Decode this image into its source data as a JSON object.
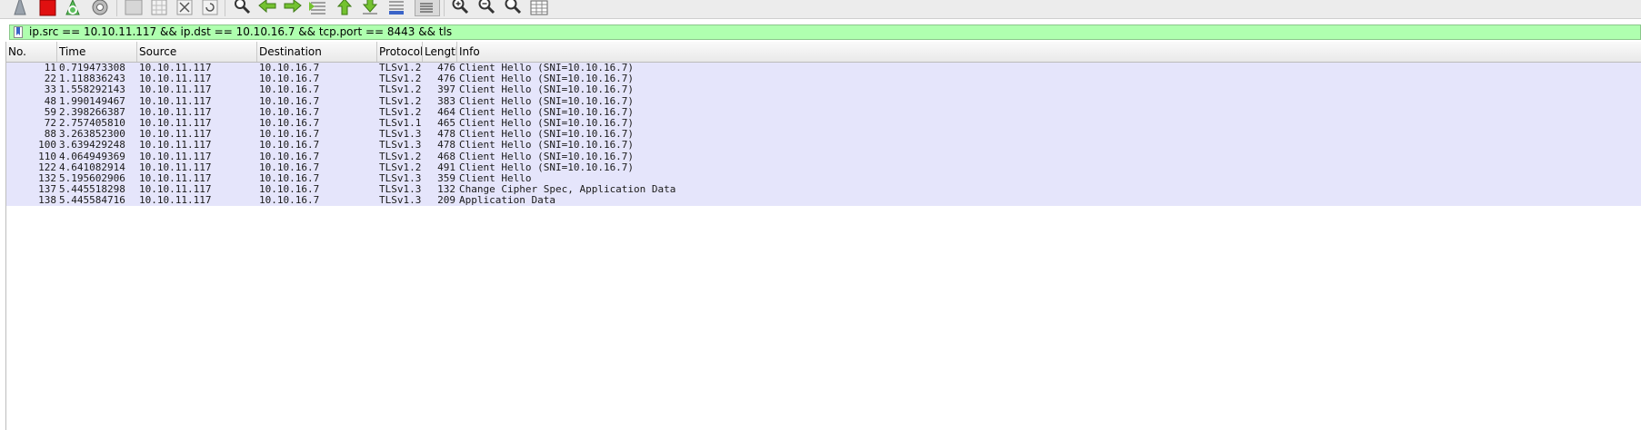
{
  "toolbar": {
    "buttons": [
      {
        "name": "start-capture-icon"
      },
      {
        "name": "stop-capture-icon"
      },
      {
        "name": "restart-capture-icon"
      },
      {
        "name": "capture-options-icon"
      },
      {
        "name": "open-file-icon"
      },
      {
        "name": "save-file-icon"
      },
      {
        "name": "close-file-icon"
      },
      {
        "name": "reload-file-icon"
      },
      {
        "name": "find-packet-icon"
      },
      {
        "name": "go-back-icon"
      },
      {
        "name": "go-forward-icon"
      },
      {
        "name": "go-to-packet-icon"
      },
      {
        "name": "go-first-packet-icon"
      },
      {
        "name": "go-last-packet-icon"
      },
      {
        "name": "autoscroll-icon"
      },
      {
        "name": "colorize-icon"
      },
      {
        "name": "zoom-in-icon"
      },
      {
        "name": "zoom-out-icon"
      },
      {
        "name": "normal-size-icon"
      },
      {
        "name": "resize-columns-icon"
      }
    ]
  },
  "filter": {
    "text": "ip.src == 10.10.11.117 && ip.dst == 10.10.16.7 && tcp.port == 8443 && tls",
    "background": "#afffaf"
  },
  "columns": [
    "No.",
    "Time",
    "Source",
    "Destination",
    "Protocol",
    "Length",
    "Info"
  ],
  "rows": [
    {
      "no": "11",
      "time": "0.719473308",
      "src": "10.10.11.117",
      "dst": "10.10.16.7",
      "proto": "TLSv1.2",
      "len": "476",
      "info": "Client Hello (SNI=10.10.16.7)"
    },
    {
      "no": "22",
      "time": "1.118836243",
      "src": "10.10.11.117",
      "dst": "10.10.16.7",
      "proto": "TLSv1.2",
      "len": "476",
      "info": "Client Hello (SNI=10.10.16.7)"
    },
    {
      "no": "33",
      "time": "1.558292143",
      "src": "10.10.11.117",
      "dst": "10.10.16.7",
      "proto": "TLSv1.2",
      "len": "397",
      "info": "Client Hello (SNI=10.10.16.7)"
    },
    {
      "no": "48",
      "time": "1.990149467",
      "src": "10.10.11.117",
      "dst": "10.10.16.7",
      "proto": "TLSv1.2",
      "len": "383",
      "info": "Client Hello (SNI=10.10.16.7)"
    },
    {
      "no": "59",
      "time": "2.398266387",
      "src": "10.10.11.117",
      "dst": "10.10.16.7",
      "proto": "TLSv1.2",
      "len": "464",
      "info": "Client Hello (SNI=10.10.16.7)"
    },
    {
      "no": "72",
      "time": "2.757405810",
      "src": "10.10.11.117",
      "dst": "10.10.16.7",
      "proto": "TLSv1.1",
      "len": "465",
      "info": "Client Hello (SNI=10.10.16.7)"
    },
    {
      "no": "88",
      "time": "3.263852300",
      "src": "10.10.11.117",
      "dst": "10.10.16.7",
      "proto": "TLSv1.3",
      "len": "478",
      "info": "Client Hello (SNI=10.10.16.7)"
    },
    {
      "no": "100",
      "time": "3.639429248",
      "src": "10.10.11.117",
      "dst": "10.10.16.7",
      "proto": "TLSv1.3",
      "len": "478",
      "info": "Client Hello (SNI=10.10.16.7)"
    },
    {
      "no": "110",
      "time": "4.064949369",
      "src": "10.10.11.117",
      "dst": "10.10.16.7",
      "proto": "TLSv1.2",
      "len": "468",
      "info": "Client Hello (SNI=10.10.16.7)"
    },
    {
      "no": "122",
      "time": "4.641082914",
      "src": "10.10.11.117",
      "dst": "10.10.16.7",
      "proto": "TLSv1.2",
      "len": "491",
      "info": "Client Hello (SNI=10.10.16.7)"
    },
    {
      "no": "132",
      "time": "5.195602906",
      "src": "10.10.11.117",
      "dst": "10.10.16.7",
      "proto": "TLSv1.3",
      "len": "359",
      "info": "Client Hello"
    },
    {
      "no": "137",
      "time": "5.445518298",
      "src": "10.10.11.117",
      "dst": "10.10.16.7",
      "proto": "TLSv1.3",
      "len": "132",
      "info": "Change Cipher Spec, Application Data"
    },
    {
      "no": "138",
      "time": "5.445584716",
      "src": "10.10.11.117",
      "dst": "10.10.16.7",
      "proto": "TLSv1.3",
      "len": "209",
      "info": "Application Data"
    }
  ],
  "colors": {
    "row_background": "#e5e5fb",
    "filter_valid": "#afffaf"
  }
}
